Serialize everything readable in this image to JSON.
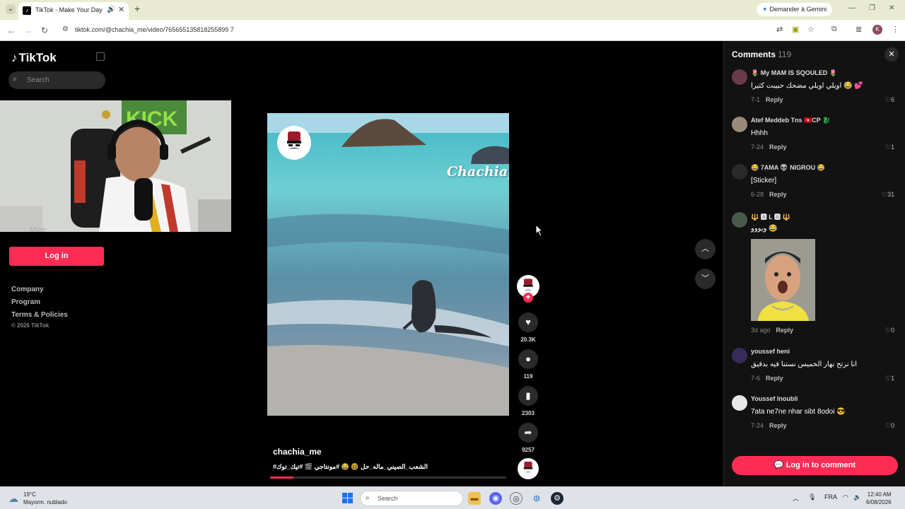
{
  "browser": {
    "tab_title": "TikTok - Make Your Day",
    "tab_icons": {
      "favicon": "tiktok-favicon",
      "audio": "speaker-icon",
      "close": "close-icon"
    },
    "new_tab": "+",
    "gemini_label": "Demander à Gemini",
    "url": "tiktok.com/@chachia_me/video/765655135818255899 7"
  },
  "sidebar": {
    "logo": "TikTok",
    "search_placeholder": "Search",
    "more": "More",
    "login": "Log in",
    "footer": [
      "Company",
      "Program",
      "Terms & Policies"
    ],
    "copyright": "© 2026 TikTok"
  },
  "video": {
    "watermark": "Chachia_m",
    "author": "chachia_me",
    "caption": "#الشعب_الصيني_ماله_حل 🤓 😂 #مونتاجي 🎬 #تيك_توك",
    "progress": 0.1
  },
  "actions": {
    "likes": "20.3K",
    "comments": "119",
    "saves": "2303",
    "shares": "9257"
  },
  "comments_panel": {
    "title": "Comments",
    "count": "119",
    "items": [
      {
        "name": "🌷 My MAM IS SQOULED 🌷",
        "text": "اويلي اويلي مضحك حبيبت كثيرا 😂 💕",
        "date": "7-1",
        "reply": "Reply",
        "likes": "6"
      },
      {
        "name": "Atef Meddeb Tns 🇹🇳CP 🐉",
        "text": "Hhhh",
        "date": "7-24",
        "reply": "Reply",
        "likes": "1"
      },
      {
        "name": "😂 7AMA 👽 NIGROU 😂",
        "text": "[Sticker]",
        "date": "6-28",
        "reply": "Reply",
        "likes": "31"
      },
      {
        "name": "🔱 🅰 L 🅰 🔱",
        "text": "ويووو 😂",
        "date": "3d ago",
        "reply": "Reply",
        "likes": "0"
      },
      {
        "name": "youssef heni",
        "text": "انا نرتح نهار الخميس نستنا فيه بدقيق",
        "date": "7-6",
        "reply": "Reply",
        "likes": "1"
      },
      {
        "name": "Youssef Inoubli",
        "text": "7ata ne7ne nhar sibt 8odoi 😎",
        "date": "7-24",
        "reply": "Reply",
        "likes": "0"
      }
    ],
    "login_label": "Log in to comment"
  },
  "taskbar": {
    "weather_temp": "19°C",
    "weather_desc": "Mayorm. nublado",
    "search": "Search",
    "lang": "FRA",
    "time": "12:40 AM",
    "date": "6/08/2026"
  }
}
